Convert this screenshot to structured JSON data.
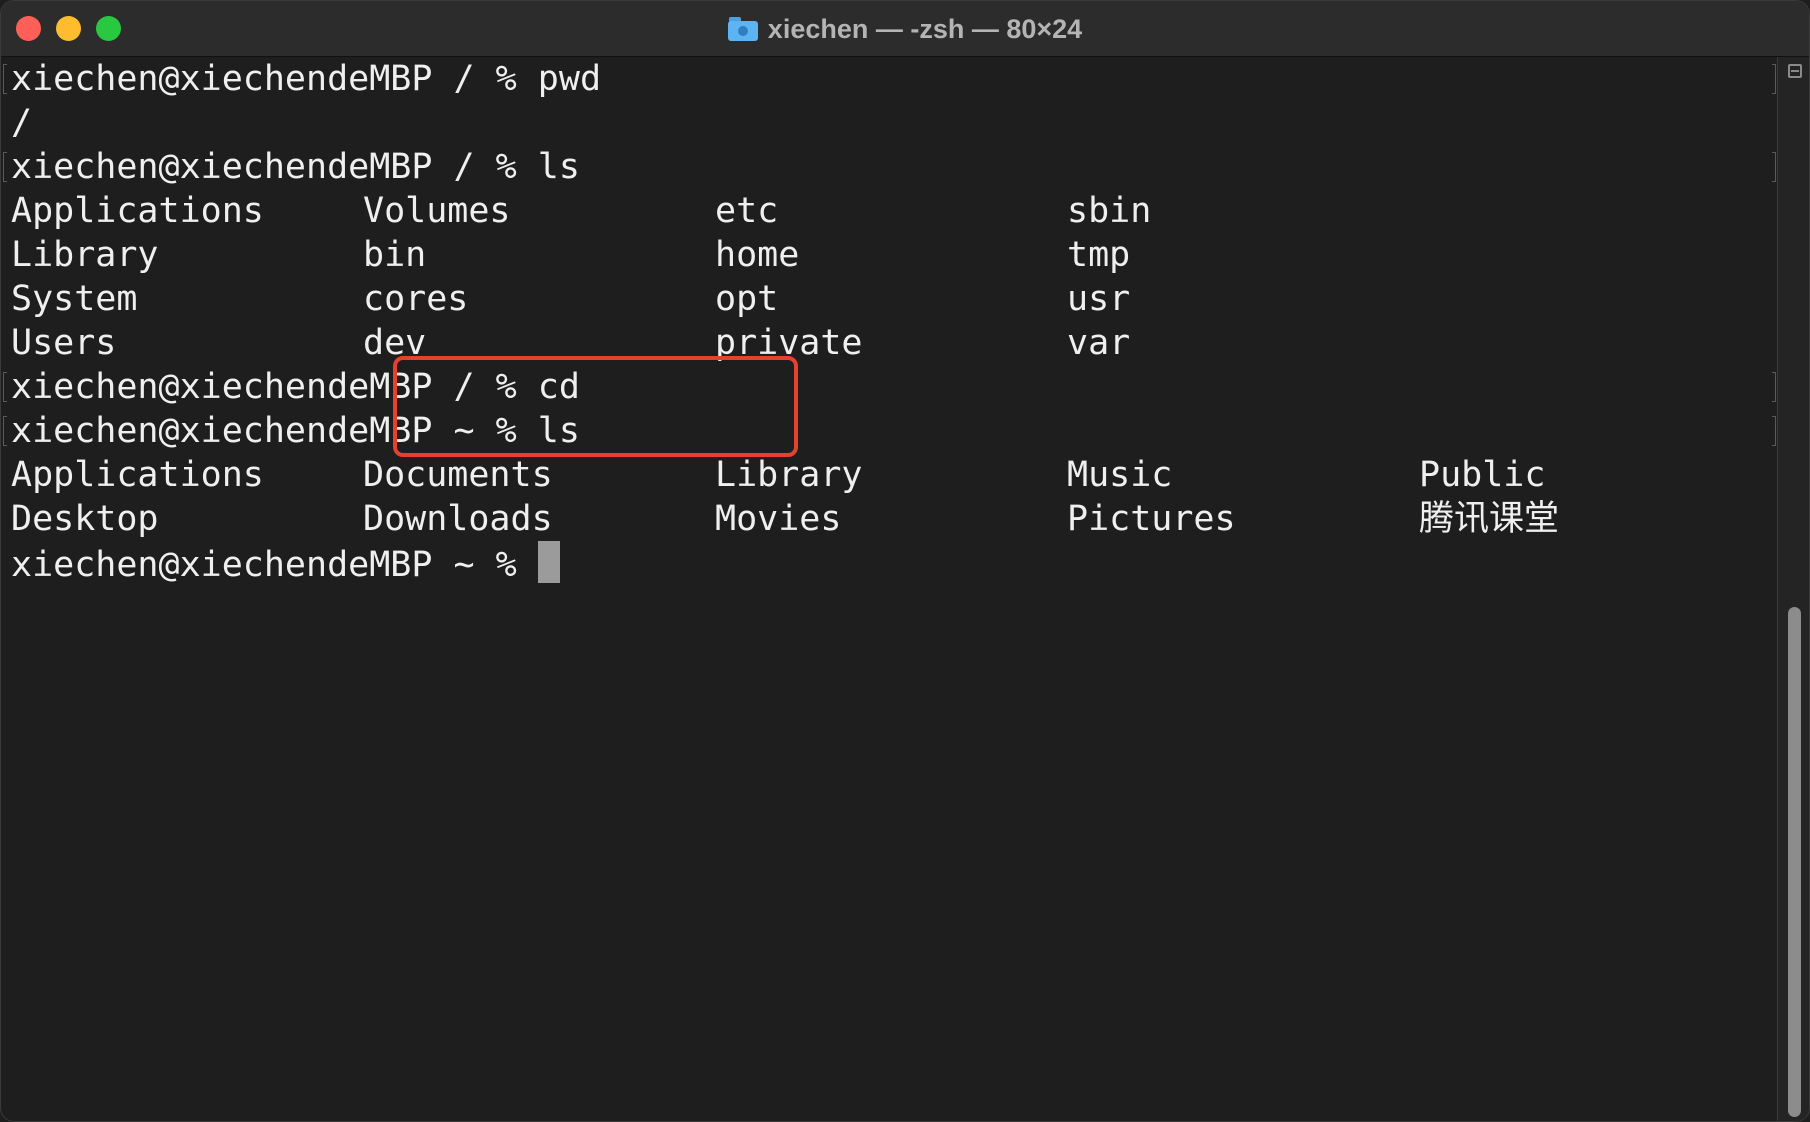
{
  "window": {
    "title": "xiechen — -zsh — 80×24"
  },
  "terminal": {
    "prompt_root": "xiechen@xiechendeMBP / % ",
    "prompt_home": "xiechen@xiechendeMBP ~ % ",
    "lines": [
      {
        "text": "xiechen@xiechendeMBP / % pwd",
        "marked": true
      },
      {
        "text": "/",
        "marked": false
      },
      {
        "text": "xiechen@xiechendeMBP / % ls",
        "marked": true
      },
      {
        "text": "xiechen@xiechendeMBP / % cd",
        "marked": true
      },
      {
        "text": "xiechen@xiechendeMBP ~ % ls",
        "marked": true
      },
      {
        "text": "xiechen@xiechendeMBP ~ % ",
        "marked": false
      }
    ],
    "root_listing": [
      [
        "Applications",
        "Volumes",
        "etc",
        "sbin"
      ],
      [
        "Library",
        "bin",
        "home",
        "tmp"
      ],
      [
        "System",
        "cores",
        "opt",
        "usr"
      ],
      [
        "Users",
        "dev",
        "private",
        "var"
      ]
    ],
    "home_listing": [
      [
        "Applications",
        "Documents",
        "Library",
        "Music",
        "Public"
      ],
      [
        "Desktop",
        "Downloads",
        "Movies",
        "Pictures",
        "腾讯课堂"
      ]
    ]
  },
  "annotation": {
    "color": "#e8402e"
  },
  "colors": {
    "background": "#1e1e1e",
    "text": "#efefef",
    "titlebar": "#2c2c2c"
  },
  "icons": {
    "title_icon": "folder-icon",
    "scrollbar_icon": "split-pane-icon"
  }
}
